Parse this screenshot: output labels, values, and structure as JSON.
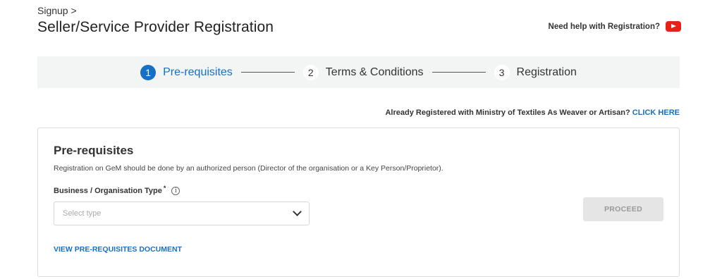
{
  "breadcrumb": "Signup >",
  "page_title": "Seller/Service Provider Registration",
  "help": {
    "text": "Need help with Registration?",
    "icon": "youtube-icon"
  },
  "stepper": {
    "steps": [
      {
        "number": "1",
        "label": "Pre-requisites",
        "state": "active"
      },
      {
        "number": "2",
        "label": "Terms & Conditions",
        "state": "inactive"
      },
      {
        "number": "3",
        "label": "Registration",
        "state": "inactive"
      }
    ]
  },
  "already_registered": {
    "text": "Already Registered with Ministry of Textiles As Weaver or Artisan?",
    "link": "CLICK HERE"
  },
  "card": {
    "title": "Pre-requisites",
    "description": "Registration on GeM should be done by an authorized person (Director of the organisation or a Key Person/Proprietor).",
    "field_label": "Business / Organisation Type",
    "required_marker": "*",
    "info_glyph": "i",
    "select_placeholder": "Select type",
    "proceed_label": "PROCEED",
    "view_doc_link": "VIEW PRE-REQUISITES DOCUMENT"
  },
  "colors": {
    "accent": "#1670c5",
    "youtube": "#e62117",
    "stepper_bg": "#f3f4f4"
  }
}
